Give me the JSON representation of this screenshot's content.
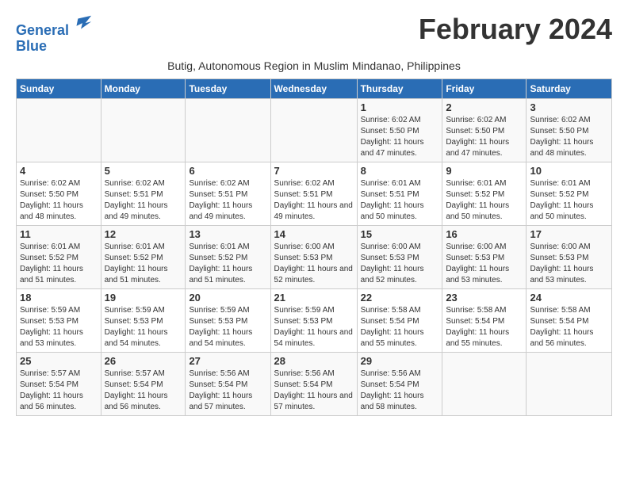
{
  "logo": {
    "line1": "General",
    "line2": "Blue"
  },
  "title": "February 2024",
  "subtitle": "Butig, Autonomous Region in Muslim Mindanao, Philippines",
  "days_of_week": [
    "Sunday",
    "Monday",
    "Tuesday",
    "Wednesday",
    "Thursday",
    "Friday",
    "Saturday"
  ],
  "weeks": [
    [
      {
        "day": "",
        "info": ""
      },
      {
        "day": "",
        "info": ""
      },
      {
        "day": "",
        "info": ""
      },
      {
        "day": "",
        "info": ""
      },
      {
        "day": "1",
        "info": "Sunrise: 6:02 AM\nSunset: 5:50 PM\nDaylight: 11 hours and 47 minutes."
      },
      {
        "day": "2",
        "info": "Sunrise: 6:02 AM\nSunset: 5:50 PM\nDaylight: 11 hours and 47 minutes."
      },
      {
        "day": "3",
        "info": "Sunrise: 6:02 AM\nSunset: 5:50 PM\nDaylight: 11 hours and 48 minutes."
      }
    ],
    [
      {
        "day": "4",
        "info": "Sunrise: 6:02 AM\nSunset: 5:50 PM\nDaylight: 11 hours and 48 minutes."
      },
      {
        "day": "5",
        "info": "Sunrise: 6:02 AM\nSunset: 5:51 PM\nDaylight: 11 hours and 49 minutes."
      },
      {
        "day": "6",
        "info": "Sunrise: 6:02 AM\nSunset: 5:51 PM\nDaylight: 11 hours and 49 minutes."
      },
      {
        "day": "7",
        "info": "Sunrise: 6:02 AM\nSunset: 5:51 PM\nDaylight: 11 hours and 49 minutes."
      },
      {
        "day": "8",
        "info": "Sunrise: 6:01 AM\nSunset: 5:51 PM\nDaylight: 11 hours and 50 minutes."
      },
      {
        "day": "9",
        "info": "Sunrise: 6:01 AM\nSunset: 5:52 PM\nDaylight: 11 hours and 50 minutes."
      },
      {
        "day": "10",
        "info": "Sunrise: 6:01 AM\nSunset: 5:52 PM\nDaylight: 11 hours and 50 minutes."
      }
    ],
    [
      {
        "day": "11",
        "info": "Sunrise: 6:01 AM\nSunset: 5:52 PM\nDaylight: 11 hours and 51 minutes."
      },
      {
        "day": "12",
        "info": "Sunrise: 6:01 AM\nSunset: 5:52 PM\nDaylight: 11 hours and 51 minutes."
      },
      {
        "day": "13",
        "info": "Sunrise: 6:01 AM\nSunset: 5:52 PM\nDaylight: 11 hours and 51 minutes."
      },
      {
        "day": "14",
        "info": "Sunrise: 6:00 AM\nSunset: 5:53 PM\nDaylight: 11 hours and 52 minutes."
      },
      {
        "day": "15",
        "info": "Sunrise: 6:00 AM\nSunset: 5:53 PM\nDaylight: 11 hours and 52 minutes."
      },
      {
        "day": "16",
        "info": "Sunrise: 6:00 AM\nSunset: 5:53 PM\nDaylight: 11 hours and 53 minutes."
      },
      {
        "day": "17",
        "info": "Sunrise: 6:00 AM\nSunset: 5:53 PM\nDaylight: 11 hours and 53 minutes."
      }
    ],
    [
      {
        "day": "18",
        "info": "Sunrise: 5:59 AM\nSunset: 5:53 PM\nDaylight: 11 hours and 53 minutes."
      },
      {
        "day": "19",
        "info": "Sunrise: 5:59 AM\nSunset: 5:53 PM\nDaylight: 11 hours and 54 minutes."
      },
      {
        "day": "20",
        "info": "Sunrise: 5:59 AM\nSunset: 5:53 PM\nDaylight: 11 hours and 54 minutes."
      },
      {
        "day": "21",
        "info": "Sunrise: 5:59 AM\nSunset: 5:53 PM\nDaylight: 11 hours and 54 minutes."
      },
      {
        "day": "22",
        "info": "Sunrise: 5:58 AM\nSunset: 5:54 PM\nDaylight: 11 hours and 55 minutes."
      },
      {
        "day": "23",
        "info": "Sunrise: 5:58 AM\nSunset: 5:54 PM\nDaylight: 11 hours and 55 minutes."
      },
      {
        "day": "24",
        "info": "Sunrise: 5:58 AM\nSunset: 5:54 PM\nDaylight: 11 hours and 56 minutes."
      }
    ],
    [
      {
        "day": "25",
        "info": "Sunrise: 5:57 AM\nSunset: 5:54 PM\nDaylight: 11 hours and 56 minutes."
      },
      {
        "day": "26",
        "info": "Sunrise: 5:57 AM\nSunset: 5:54 PM\nDaylight: 11 hours and 56 minutes."
      },
      {
        "day": "27",
        "info": "Sunrise: 5:56 AM\nSunset: 5:54 PM\nDaylight: 11 hours and 57 minutes."
      },
      {
        "day": "28",
        "info": "Sunrise: 5:56 AM\nSunset: 5:54 PM\nDaylight: 11 hours and 57 minutes."
      },
      {
        "day": "29",
        "info": "Sunrise: 5:56 AM\nSunset: 5:54 PM\nDaylight: 11 hours and 58 minutes."
      },
      {
        "day": "",
        "info": ""
      },
      {
        "day": "",
        "info": ""
      }
    ]
  ]
}
